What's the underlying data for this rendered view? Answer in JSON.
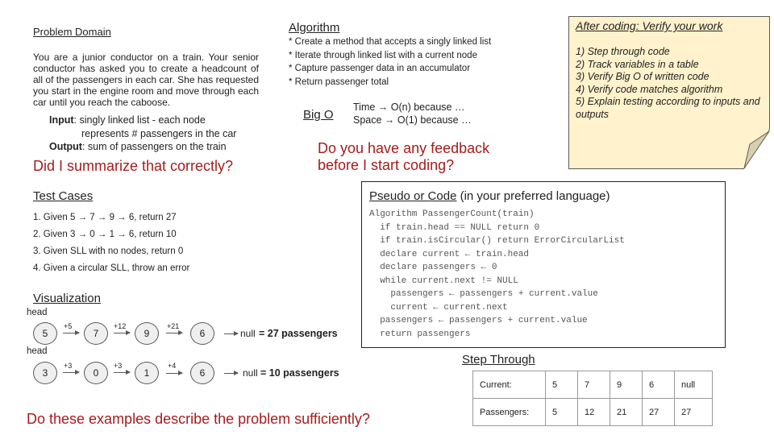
{
  "problem_domain": {
    "title": "Problem Domain",
    "body": "You are a junior conductor on a train. Your senior conductor has asked you to create a headcount of all of the passengers in each car. She has requested you start in the engine room and move through each car until you reach the caboose.",
    "input_label": "Input",
    "input_text": ": singly linked list - each node",
    "input_text2": "represents # passengers in the car",
    "output_label": "Output",
    "output_text": ": sum of passengers on the train",
    "question": "Did I summarize that correctly?"
  },
  "algorithm": {
    "title": "Algorithm",
    "steps": [
      "* Create a method that accepts a singly linked list",
      "* Iterate through linked list with a current node",
      "* Capture passenger data in an accumulator",
      "* Return passenger total"
    ],
    "big_o_label": "Big O",
    "time": "Time → O(n) because …",
    "space": "Space → O(1) because …",
    "question_line1": "Do you have any feedback",
    "question_line2": "before I start coding?"
  },
  "verify_note": {
    "title": "After coding: Verify your work",
    "items": [
      "1) Step through code",
      "2) Track variables in a table",
      "3) Verify Big O of written code",
      "4) Verify code matches algorithm",
      "5) Explain testing according to inputs and outputs"
    ],
    "bg_color": "#fff2cc"
  },
  "test_cases": {
    "title": "Test Cases",
    "items": [
      "1. Given 5 → 7 → 9 → 6, return 27",
      "2. Given 3 → 0 → 1 → 6, return 10",
      "3. Given SLL with no nodes, return 0",
      "4. Given a circular SLL, throw an error"
    ]
  },
  "visualization": {
    "title": "Visualization",
    "lists": [
      {
        "head_label": "head",
        "nodes": [
          "5",
          "7",
          "9",
          "6"
        ],
        "deltas": [
          "+5",
          "+12",
          "+21"
        ],
        "null_label": "null",
        "total": "= 27 passengers"
      },
      {
        "head_label": "head",
        "nodes": [
          "3",
          "0",
          "1",
          "6"
        ],
        "deltas": [
          "+3",
          "+3",
          "+4"
        ],
        "null_label": "null",
        "total": "= 10 passengers"
      }
    ],
    "question": "Do these examples describe the problem sufficiently?"
  },
  "code": {
    "title": "Pseudo or Code",
    "subtitle": " (in your preferred language)",
    "lines": [
      "Algorithm PassengerCount(train)",
      "  if train.head == NULL return 0",
      "  if train.isCircular() return ErrorCircularList",
      "  declare current ← train.head",
      "  declare passengers ← 0",
      "  while current.next != NULL",
      "    passengers ← passengers + current.value",
      "    current ← current.next",
      "  passengers ← passengers + current.value",
      "  return passengers"
    ]
  },
  "step_through": {
    "title": "Step Through",
    "rows": [
      {
        "label": "Current:",
        "values": [
          "5",
          "7",
          "9",
          "6",
          "null"
        ]
      },
      {
        "label": "Passengers:",
        "values": [
          "5",
          "12",
          "21",
          "27",
          "27"
        ]
      }
    ]
  },
  "colors": {
    "question_red": "#a61c1c",
    "node_fill": "#efefef",
    "note_fold": "#d9cfae"
  }
}
